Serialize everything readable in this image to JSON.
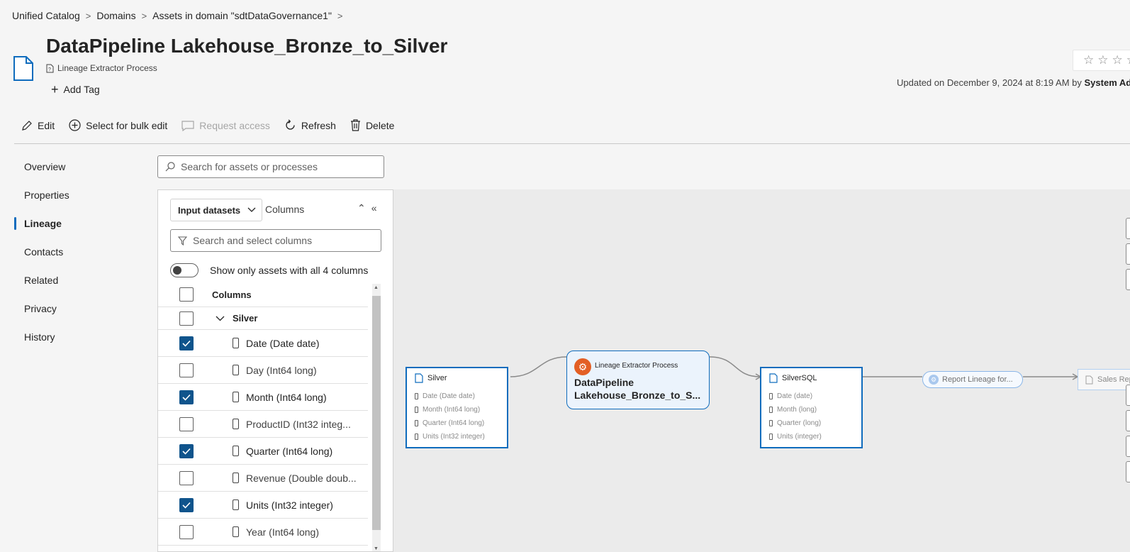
{
  "breadcrumb": [
    "Unified Catalog",
    "Domains",
    "Assets in domain \"sdtDataGovernance1\""
  ],
  "asset": {
    "title": "DataPipeline Lakehouse_Bronze_to_Silver",
    "type": "Lineage Extractor Process",
    "add_tag": "Add Tag",
    "updated_prefix": "Updated on December 9, 2024 at 8:19 AM by",
    "updated_by": "System Adr"
  },
  "commands": {
    "edit": "Edit",
    "bulk": "Select for bulk edit",
    "request": "Request access",
    "refresh": "Refresh",
    "delete": "Delete"
  },
  "nav": [
    "Overview",
    "Properties",
    "Lineage",
    "Contacts",
    "Related",
    "Privacy",
    "History"
  ],
  "nav_active": "Lineage",
  "lineage_search_placeholder": "Search for assets or processes",
  "panel": {
    "dropdown": "Input datasets",
    "tab": "Columns",
    "column_search_placeholder": "Search and select columns",
    "toggle_label": "Show only assets with all 4 columns",
    "header": "Columns",
    "group": "Silver",
    "columns": [
      {
        "label": "Date (Date date)",
        "checked": true
      },
      {
        "label": "Day (Int64 long)",
        "checked": false
      },
      {
        "label": "Month (Int64 long)",
        "checked": true
      },
      {
        "label": "ProductID (Int32 integ...",
        "checked": false
      },
      {
        "label": "Quarter (Int64 long)",
        "checked": true
      },
      {
        "label": "Revenue (Double doub...",
        "checked": false
      },
      {
        "label": "Units (Int32 integer)",
        "checked": true
      },
      {
        "label": "Year (Int64 long)",
        "checked": false
      }
    ]
  },
  "graph": {
    "silver": {
      "name": "Silver",
      "cols": [
        "Date (Date date)",
        "Month (Int64 long)",
        "Quarter (Int64 long)",
        "Units (Int32 integer)"
      ]
    },
    "process": {
      "type": "Lineage Extractor Process",
      "name": "DataPipeline Lakehouse_Bronze_to_S..."
    },
    "silversql": {
      "name": "SilverSQL",
      "cols": [
        "Date (date)",
        "Month (long)",
        "Quarter (long)",
        "Units (integer)"
      ]
    },
    "report_pill": "Report Lineage for...",
    "sales_node": "Sales Repo"
  },
  "colors": {
    "accent": "#0f6cbd",
    "checked": "#0f548c",
    "process_icon": "#e35f25"
  }
}
